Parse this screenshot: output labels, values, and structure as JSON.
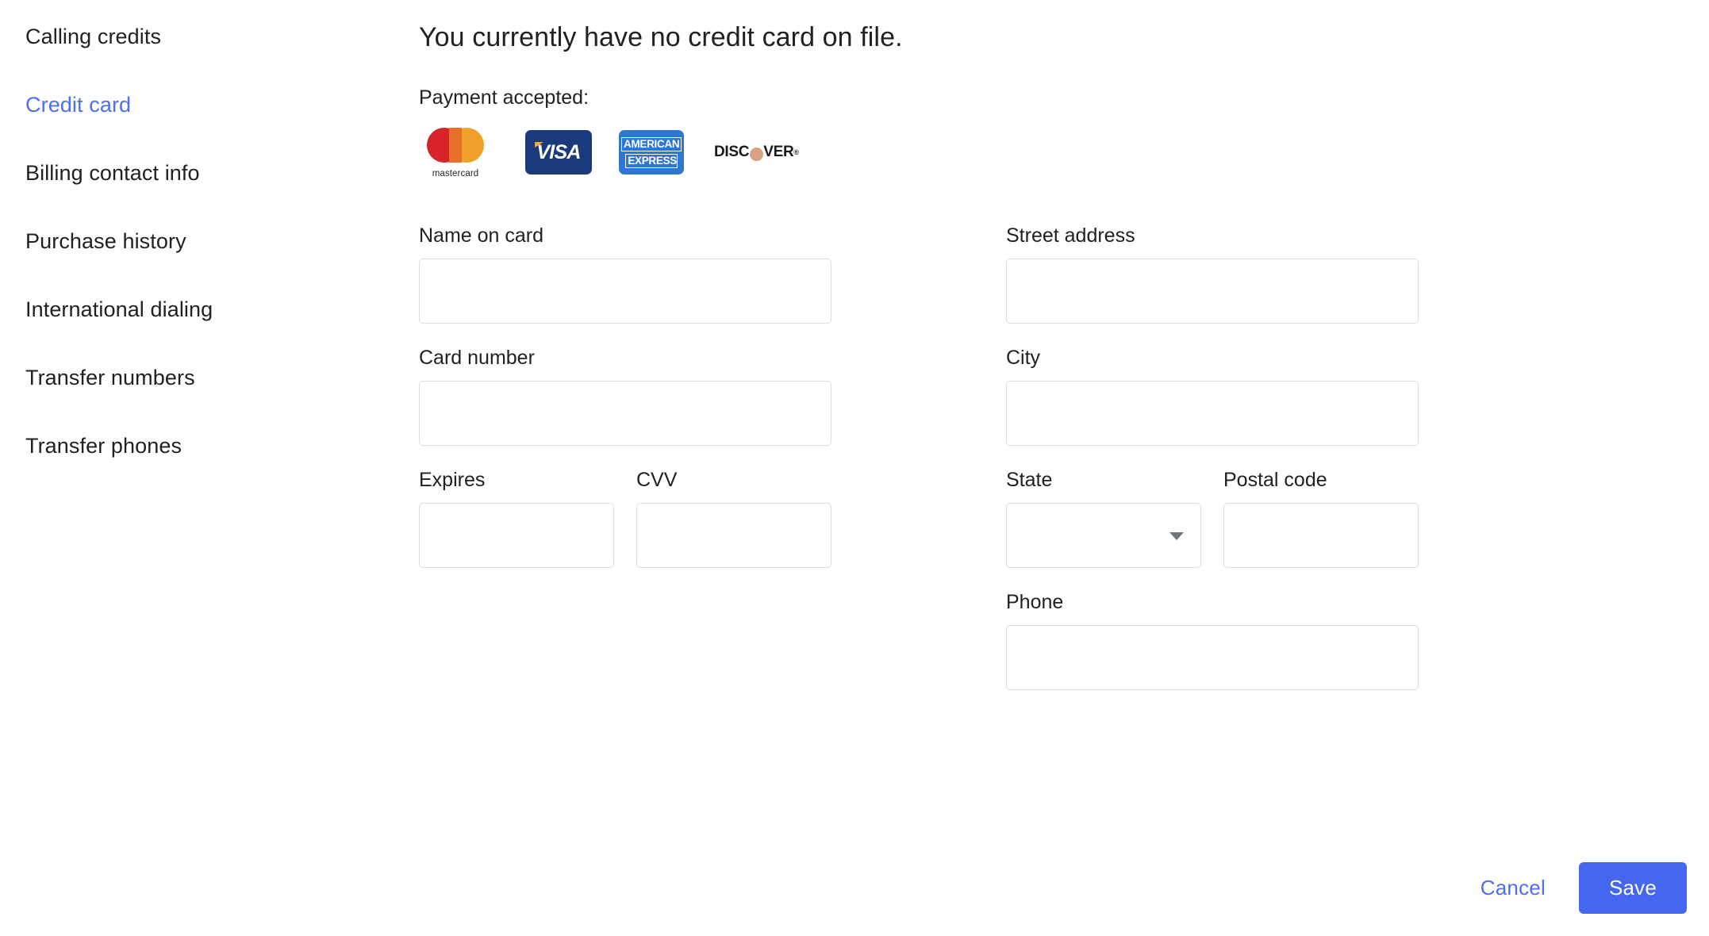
{
  "sidebar": {
    "items": [
      {
        "label": "Calling credits",
        "active": false
      },
      {
        "label": "Credit card",
        "active": true
      },
      {
        "label": "Billing contact info",
        "active": false
      },
      {
        "label": "Purchase history",
        "active": false
      },
      {
        "label": "International dialing",
        "active": false
      },
      {
        "label": "Transfer numbers",
        "active": false
      },
      {
        "label": "Transfer phones",
        "active": false
      }
    ]
  },
  "main": {
    "headline": "You currently have no credit card on file.",
    "payment_label": "Payment accepted:",
    "cards": [
      {
        "name": "mastercard-logo",
        "text": "mastercard"
      },
      {
        "name": "visa-logo",
        "text": "VISA"
      },
      {
        "name": "american-express-logo",
        "line1": "AMERICAN",
        "line2": "EXPRESS"
      },
      {
        "name": "discover-logo",
        "prefix": "DISC",
        "suffix": "VER",
        "tm": "®"
      }
    ]
  },
  "form": {
    "left": {
      "name_on_card": {
        "label": "Name on card",
        "value": "",
        "placeholder": ""
      },
      "card_number": {
        "label": "Card number",
        "value": "",
        "placeholder": ""
      },
      "expires": {
        "label": "Expires",
        "value": "",
        "placeholder": ""
      },
      "cvv": {
        "label": "CVV",
        "value": "",
        "placeholder": ""
      }
    },
    "right": {
      "street_address": {
        "label": "Street address",
        "value": "",
        "placeholder": ""
      },
      "city": {
        "label": "City",
        "value": "",
        "placeholder": ""
      },
      "state": {
        "label": "State",
        "value": "",
        "options": [
          ""
        ]
      },
      "postal_code": {
        "label": "Postal code",
        "value": "",
        "placeholder": ""
      },
      "phone": {
        "label": "Phone",
        "value": "",
        "placeholder": ""
      }
    }
  },
  "footer": {
    "cancel_label": "Cancel",
    "save_label": "Save"
  },
  "colors": {
    "accent_blue": "#4d6ef5",
    "save_button": "#4566ef",
    "border_gray": "#dadce0",
    "text": "#202124",
    "mastercard_red": "#d8232a",
    "mastercard_orange": "#f0a02a",
    "visa_navy": "#1a3a7c",
    "visa_gold": "#f3a53a",
    "amex_blue": "#2e77d0",
    "discover_tan": "#d9a183"
  }
}
